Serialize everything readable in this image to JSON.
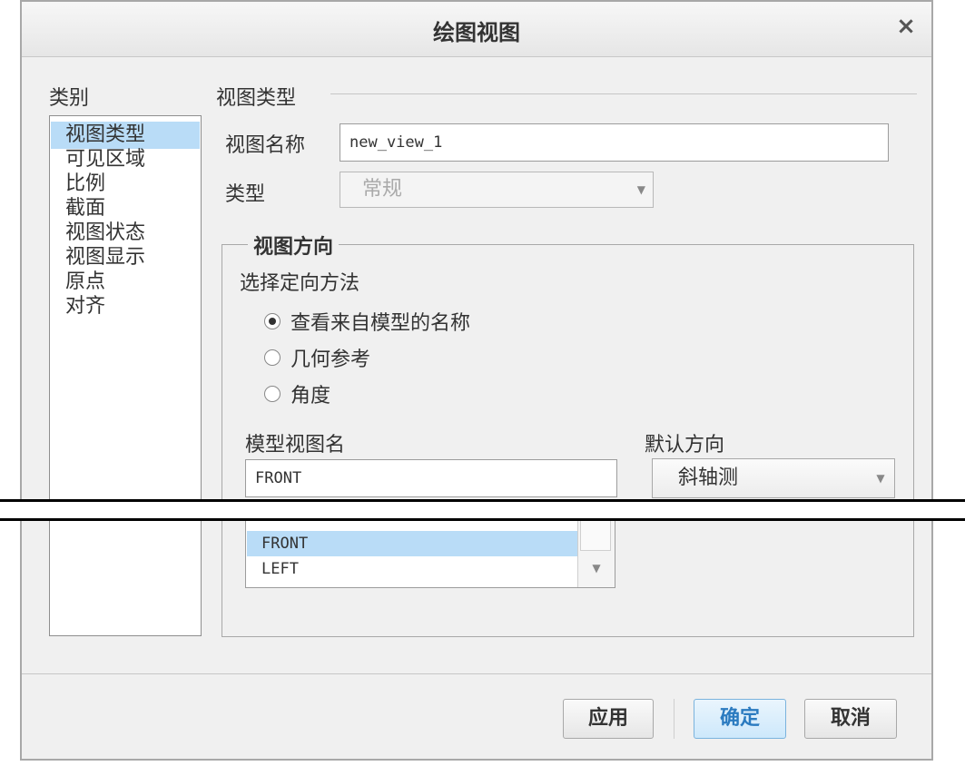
{
  "dialog": {
    "title": "绘图视图",
    "close_glyph": "×"
  },
  "sidebar": {
    "heading": "类别",
    "items": [
      {
        "label": "视图类型",
        "selected": true
      },
      {
        "label": "可见区域"
      },
      {
        "label": "比例"
      },
      {
        "label": "截面"
      },
      {
        "label": "视图状态"
      },
      {
        "label": "视图显示"
      },
      {
        "label": "原点"
      },
      {
        "label": "对齐"
      }
    ]
  },
  "view_type": {
    "section_heading": "视图类型",
    "name_label": "视图名称",
    "name_value": "new_view_1",
    "type_label": "类型",
    "type_value": "常规"
  },
  "orientation": {
    "group_title": "视图方向",
    "method_label": "选择定向方法",
    "options": [
      {
        "label": "查看来自模型的名称",
        "checked": true
      },
      {
        "label": "几何参考",
        "checked": false
      },
      {
        "label": "角度",
        "checked": false
      }
    ],
    "model_view_label": "模型视图名",
    "model_view_value": "FRONT",
    "default_dir_label": "默认方向",
    "default_dir_value": "斜轴测",
    "list_items": [
      "FRONT",
      "LEFT"
    ]
  },
  "buttons": {
    "apply": "应用",
    "ok": "确定",
    "cancel": "取消"
  },
  "icons": {
    "dropdown": "chevron-down-icon",
    "close": "close-icon"
  }
}
